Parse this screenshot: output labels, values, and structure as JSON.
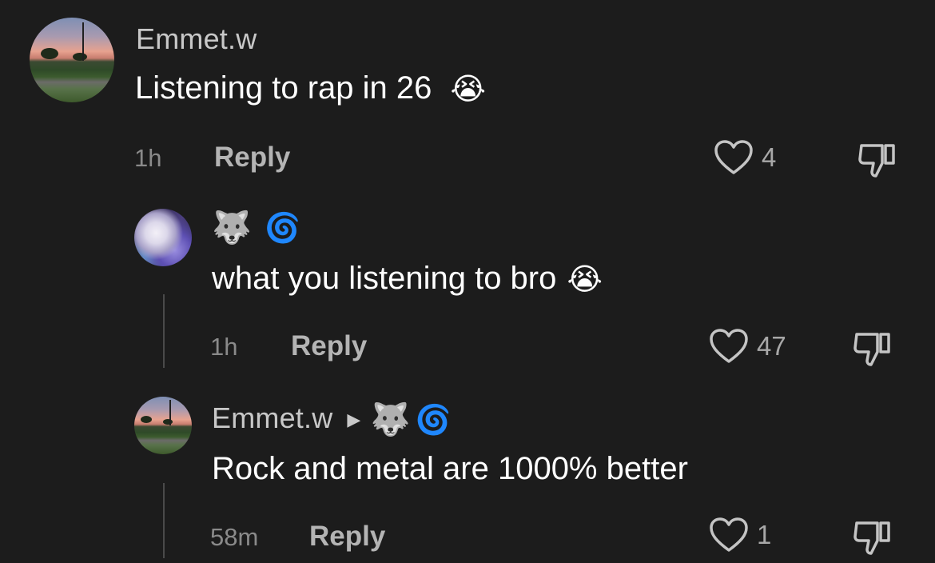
{
  "comments": [
    {
      "username": "Emmet.w",
      "text": "Listening to rap in 26",
      "text_emoji": "😭",
      "time": "1h",
      "reply_label": "Reply",
      "likes": "4",
      "avatar": "landscape-sunset-icon"
    },
    {
      "username_emojis": [
        "🐺",
        "🌀"
      ],
      "text": "what you listening to bro",
      "text_emoji": "😭",
      "time": "1h",
      "reply_label": "Reply",
      "likes": "47",
      "avatar": "anime-character-icon"
    },
    {
      "username": "Emmet.w",
      "reply_to_emojis": [
        "🐺",
        "🌀"
      ],
      "text": "Rock and metal are 1000% better",
      "time": "58m",
      "reply_label": "Reply",
      "likes": "1",
      "avatar": "landscape-sunset-icon"
    }
  ],
  "colors": {
    "background": "#1c1c1c",
    "username": "#c8c8c8",
    "text": "#ffffff",
    "meta": "#8a8a8a"
  }
}
